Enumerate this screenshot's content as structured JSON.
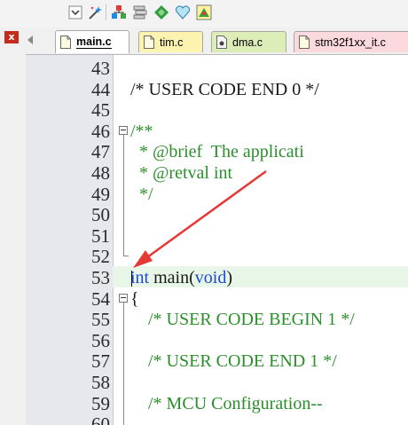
{
  "toolbar": {
    "icons": [
      "combo-dropdown-icon",
      "magic-wand-icon",
      "build-icon",
      "stack-icon",
      "green-diamond-icon",
      "heart-icon",
      "flag-icon"
    ]
  },
  "panel": {
    "close_label": "x"
  },
  "tabs": [
    {
      "label": "main.c",
      "state": "active",
      "color": "#ffffff"
    },
    {
      "label": "tim.c",
      "state": "inactive",
      "color": "#fdf3b0"
    },
    {
      "label": "dma.c",
      "state": "inactive",
      "color": "#dcedb8"
    },
    {
      "label": "stm32f1xx_it.c",
      "state": "inactive",
      "color": "#fbd9dd"
    }
  ],
  "editor": {
    "lines": [
      {
        "num": "43",
        "code": ""
      },
      {
        "num": "44",
        "code": "/* USER CODE END 0 */"
      },
      {
        "num": "45",
        "code": ""
      },
      {
        "num": "46",
        "code": "/**"
      },
      {
        "num": "47",
        "code": "  * @brief  The applicati"
      },
      {
        "num": "48",
        "code": "  * @retval int"
      },
      {
        "num": "49",
        "code": "  */"
      },
      {
        "num": "50",
        "code": ""
      },
      {
        "num": "51",
        "code": ""
      },
      {
        "num": "52",
        "code": ""
      },
      {
        "num": "53",
        "code_kw": "int",
        "code_mid": " main(",
        "code_kw2": "void",
        "code_end": ")"
      },
      {
        "num": "54",
        "code": "{"
      },
      {
        "num": "55",
        "code": "    /* USER CODE BEGIN 1 */"
      },
      {
        "num": "56",
        "code": ""
      },
      {
        "num": "57",
        "code": "    /* USER CODE END 1 */"
      },
      {
        "num": "58",
        "code": ""
      },
      {
        "num": "59",
        "code": "    /* MCU Configuration--"
      },
      {
        "num": "60",
        "code": ""
      }
    ],
    "current_line": "53",
    "colors": {
      "comment": "#2a8f2a",
      "keyword": "#1f4ad1",
      "annotation_arrow": "#e53935"
    }
  }
}
